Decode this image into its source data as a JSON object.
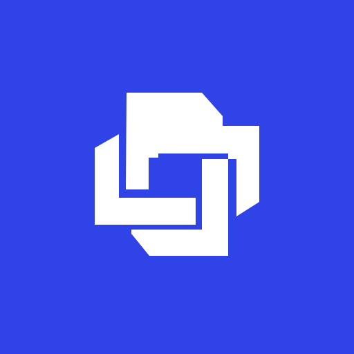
{
  "app_icon": {
    "icon": "interlocking-squares-logo-icon",
    "background_color": "#2F43E6",
    "mark_color": "#FFFFFF"
  }
}
